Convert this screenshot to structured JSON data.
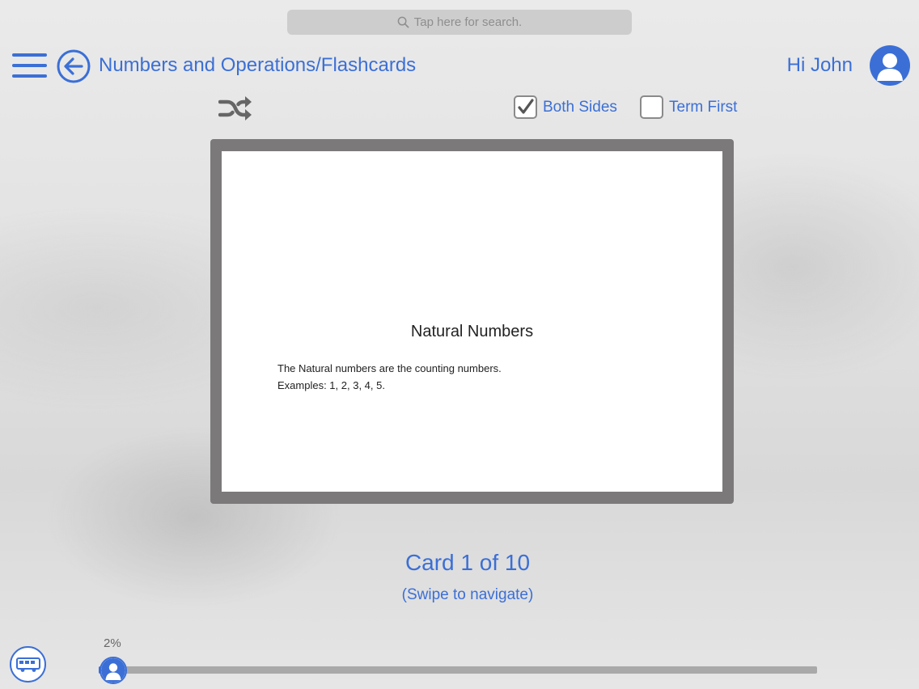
{
  "search": {
    "placeholder": "Tap here for search."
  },
  "header": {
    "breadcrumb": "Numbers and Operations/Flashcards",
    "greeting": "Hi John"
  },
  "options": {
    "both_sides": {
      "label": "Both Sides",
      "checked": true
    },
    "term_first": {
      "label": "Term First",
      "checked": false
    }
  },
  "card": {
    "term": "Natural Numbers",
    "definition_line1": "The Natural numbers are the counting numbers.",
    "definition_line2": "Examples:  1, 2, 3, 4, 5."
  },
  "navigation": {
    "counter": "Card 1 of 10",
    "hint": "(Swipe to navigate)"
  },
  "progress": {
    "label": "2%",
    "value": 0.02
  },
  "icons": {
    "menu": "hamburger-menu-icon",
    "back": "back-arrow-icon",
    "avatar": "user-avatar-icon",
    "shuffle": "shuffle-icon",
    "search": "search-icon",
    "bus": "bus-icon"
  },
  "colors": {
    "accent": "#3b6fd6",
    "card_frame": "#7b797a",
    "progress_track": "#a9a9a9"
  }
}
